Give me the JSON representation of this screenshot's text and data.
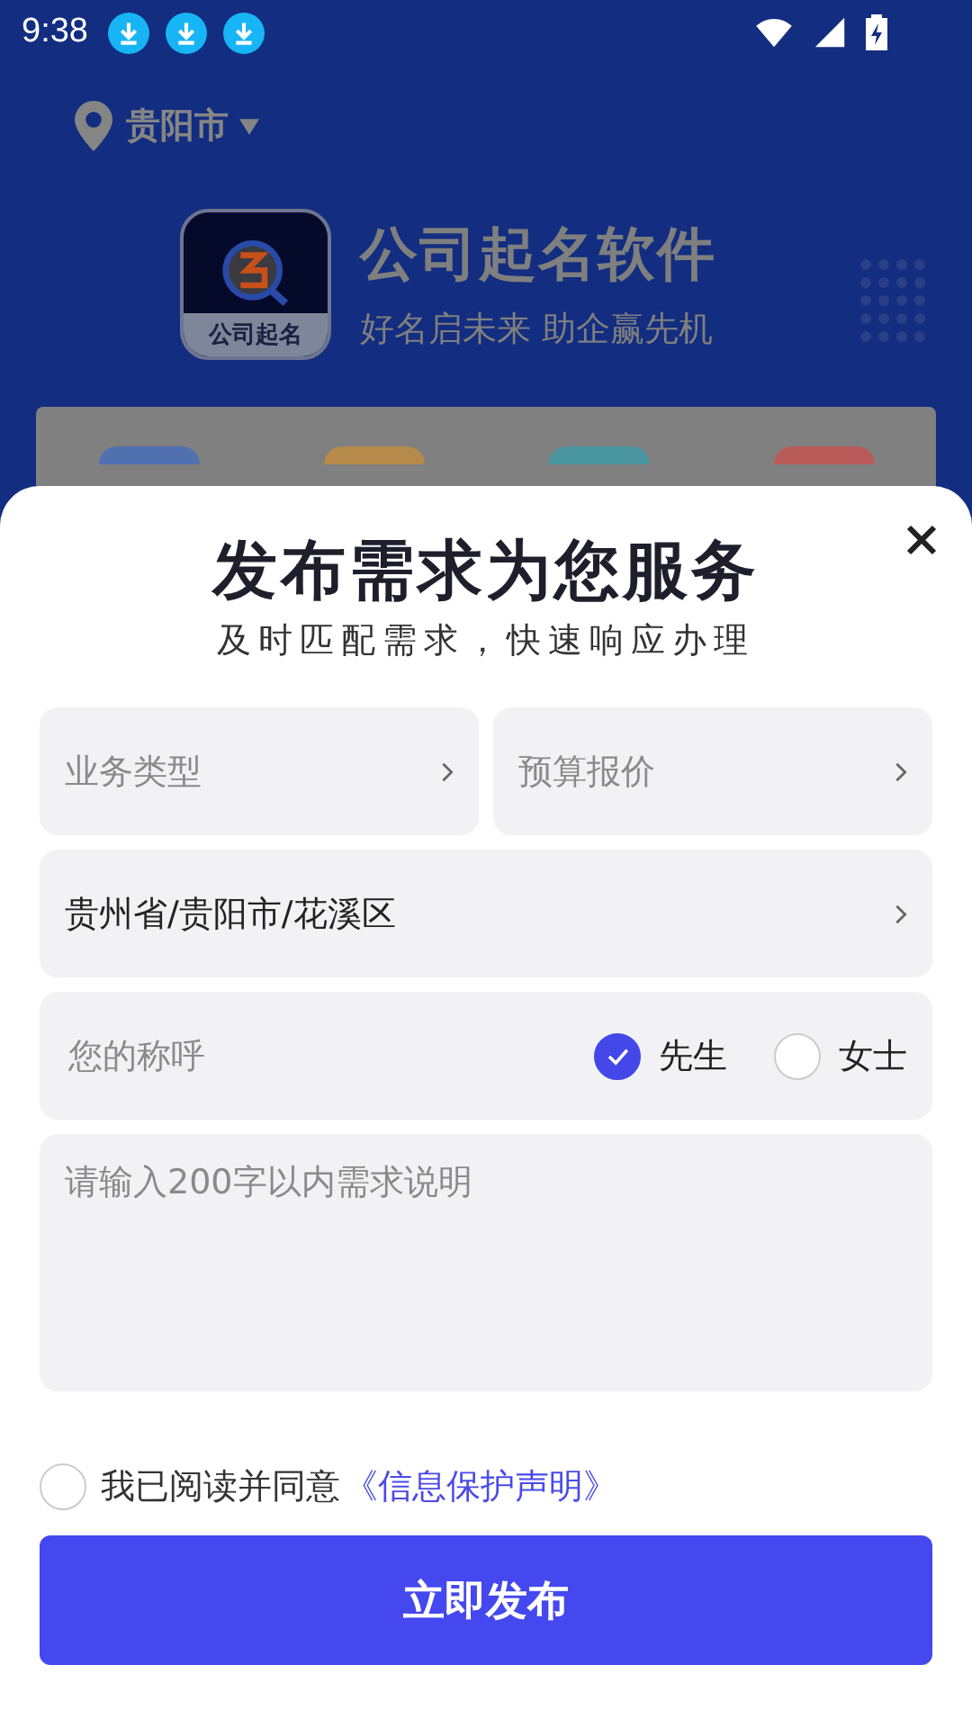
{
  "status_bar": {
    "time": "9:38",
    "notifications": [
      {
        "kind": "download"
      },
      {
        "kind": "download"
      },
      {
        "kind": "download"
      }
    ]
  },
  "location": {
    "city": "贵阳市"
  },
  "brand": {
    "logo_label": "公司起名",
    "name": "公司起名软件",
    "slogan": "好名启未来 助企赢先机"
  },
  "shortcuts": [
    {
      "color": "#5170b0"
    },
    {
      "color": "#b58a4a"
    },
    {
      "color": "#4a96a0"
    },
    {
      "color": "#b85a58"
    }
  ],
  "sheet": {
    "title": "发布需求为您服务",
    "subtitle": "及时匹配需求，快速响应办理",
    "pickers": [
      {
        "placeholder": "业务类型"
      },
      {
        "placeholder": "预算报价"
      }
    ],
    "region": {
      "value": "贵州省/贵阳市/花溪区"
    },
    "name_field": {
      "placeholder": "您的称呼"
    },
    "titles": [
      {
        "label": "先生",
        "selected": true
      },
      {
        "label": "女士",
        "selected": false
      }
    ],
    "description": {
      "placeholder": "请输入200字以内需求说明"
    },
    "agreement": {
      "checked": false,
      "text": "我已阅读并同意",
      "link": "《信息保护声明》"
    },
    "submit": "立即发布"
  }
}
